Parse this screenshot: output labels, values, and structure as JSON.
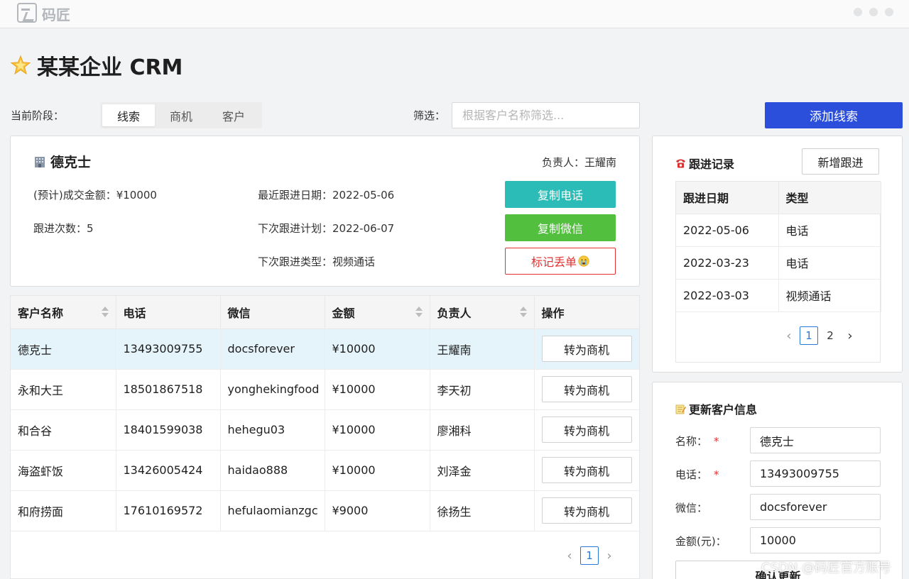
{
  "app": {
    "logo_text": "码匠"
  },
  "page": {
    "title": "某某企业 CRM"
  },
  "toolbar": {
    "stage_label": "当前阶段：",
    "stages": [
      "线索",
      "商机",
      "客户"
    ],
    "active_stage": "线索",
    "filter_label": "筛选：",
    "filter_placeholder": "根据客户名称筛选...",
    "add_button": "添加线索"
  },
  "detail": {
    "name": "德克士",
    "owner": "负责人：王耀南",
    "amount": "(预计)成交金额：¥10000",
    "follow_count": "跟进次数：5",
    "last_follow_date": "最近跟进日期：2022-05-06",
    "next_follow_plan": "下次跟进计划：2022-06-07",
    "next_follow_type": "下次跟进类型：视频通话",
    "copy_phone_button": "复制电话",
    "copy_wechat_button": "复制微信",
    "mark_lost_button": "标记丢单"
  },
  "customers_table": {
    "columns": [
      "客户名称",
      "电话",
      "微信",
      "金额",
      "负责人",
      "操作"
    ],
    "rows": [
      {
        "name": "德克士",
        "phone": "13493009755",
        "wechat": "docsforever",
        "amount": "¥10000",
        "owner": "王耀南",
        "action": "转为商机"
      },
      {
        "name": "永和大王",
        "phone": "18501867518",
        "wechat": "yonghekingfood",
        "amount": "¥10000",
        "owner": "李天初",
        "action": "转为商机"
      },
      {
        "name": "和合谷",
        "phone": "18401599038",
        "wechat": "hehegu03",
        "amount": "¥10000",
        "owner": "廖湘科",
        "action": "转为商机"
      },
      {
        "name": "海盗虾饭",
        "phone": "13426005424",
        "wechat": "haidao888",
        "amount": "¥10000",
        "owner": "刘泽金",
        "action": "转为商机"
      },
      {
        "name": "和府捞面",
        "phone": "17610169572",
        "wechat": "hefulaomianzgc",
        "amount": "¥9000",
        "owner": "徐扬生",
        "action": "转为商机"
      }
    ],
    "pagination": {
      "prev": "‹",
      "pages": [
        "1"
      ],
      "current": "1",
      "next": "›"
    }
  },
  "follow_up": {
    "title": "跟进记录",
    "add_button": "新增跟进",
    "columns": [
      "跟进日期",
      "类型"
    ],
    "rows": [
      {
        "date": "2022-05-06",
        "type": "电话"
      },
      {
        "date": "2022-03-23",
        "type": "电话"
      },
      {
        "date": "2022-03-03",
        "type": "视频通话"
      }
    ],
    "pagination": {
      "prev": "‹",
      "pages": [
        "1",
        "2"
      ],
      "current": "1",
      "next": "›"
    }
  },
  "update_form": {
    "title": "更新客户信息",
    "required_mark": "*",
    "name_label": "名称：",
    "name_value": "德克士",
    "phone_label": "电话：",
    "phone_value": "13493009755",
    "wechat_label": "微信：",
    "wechat_value": "docsforever",
    "amount_label": "金额(元)：",
    "amount_value": "10000",
    "submit_button": "确认更新"
  },
  "watermark": "CSDN @码匠官方账号",
  "colors": {
    "primary": "#2b4fdb",
    "teal": "#2bbcb7",
    "green": "#52bf3e",
    "danger": "#e53030",
    "selected_row": "#e5f4fb"
  }
}
